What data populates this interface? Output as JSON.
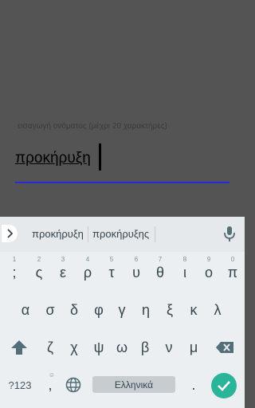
{
  "dialog": {
    "hint": "εισαγωγή ονόματος (μέχρι 20 χαρακτήρες)",
    "input_value": "προκήρυξη"
  },
  "keyboard": {
    "suggestions": [
      "προκήρυξη",
      "προκήρυξης"
    ],
    "row1": [
      {
        "key": ";",
        "num": "1"
      },
      {
        "key": "ς",
        "num": "2"
      },
      {
        "key": "ε",
        "num": "3"
      },
      {
        "key": "ρ",
        "num": "4"
      },
      {
        "key": "τ",
        "num": "5"
      },
      {
        "key": "υ",
        "num": "6"
      },
      {
        "key": "θ",
        "num": "7"
      },
      {
        "key": "ι",
        "num": "8"
      },
      {
        "key": "ο",
        "num": "9"
      },
      {
        "key": "π",
        "num": "0"
      }
    ],
    "row2": [
      "α",
      "σ",
      "δ",
      "φ",
      "γ",
      "η",
      "ξ",
      "κ",
      "λ"
    ],
    "row3": [
      "ζ",
      "χ",
      "ψ",
      "ω",
      "β",
      "ν",
      "μ"
    ],
    "symbols_label": "?123",
    "comma": ",",
    "comma_hint": "☺",
    "space_label": "Ελληνικά",
    "period": ".",
    "icons": {
      "chevron": "chevron-right-icon",
      "mic": "microphone-icon",
      "shift": "shift-icon",
      "backspace": "backspace-icon",
      "globe": "globe-icon",
      "enter": "checkmark-icon"
    },
    "colors": {
      "accent": "#2ab59a",
      "underline": "#2a2ad8"
    }
  }
}
